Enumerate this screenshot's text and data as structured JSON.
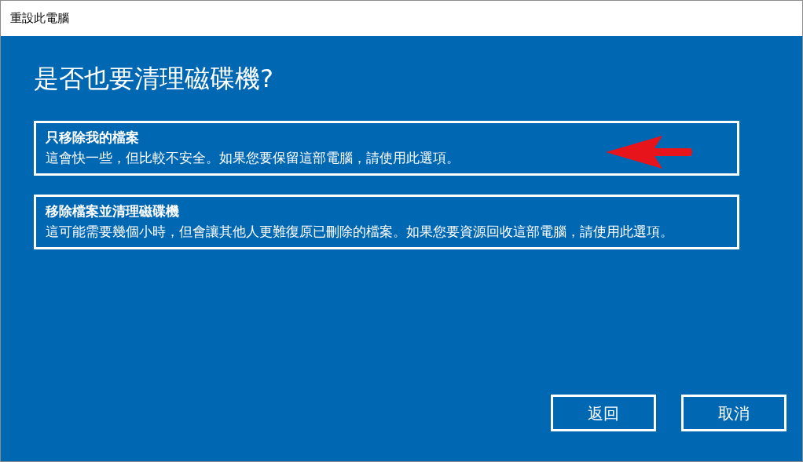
{
  "window": {
    "title": "重設此電腦"
  },
  "heading": "是否也要清理磁碟機?",
  "options": [
    {
      "title": "只移除我的檔案",
      "description": "這會快一些，但比較不安全。如果您要保留這部電腦，請使用此選項。",
      "annotated": true
    },
    {
      "title": "移除檔案並清理磁碟機",
      "description": "這可能需要幾個小時，但會讓其他人更難復原已刪除的檔案。如果您要資源回收這部電腦，請使用此選項。",
      "annotated": false
    }
  ],
  "buttons": [
    "返回",
    "取消"
  ]
}
